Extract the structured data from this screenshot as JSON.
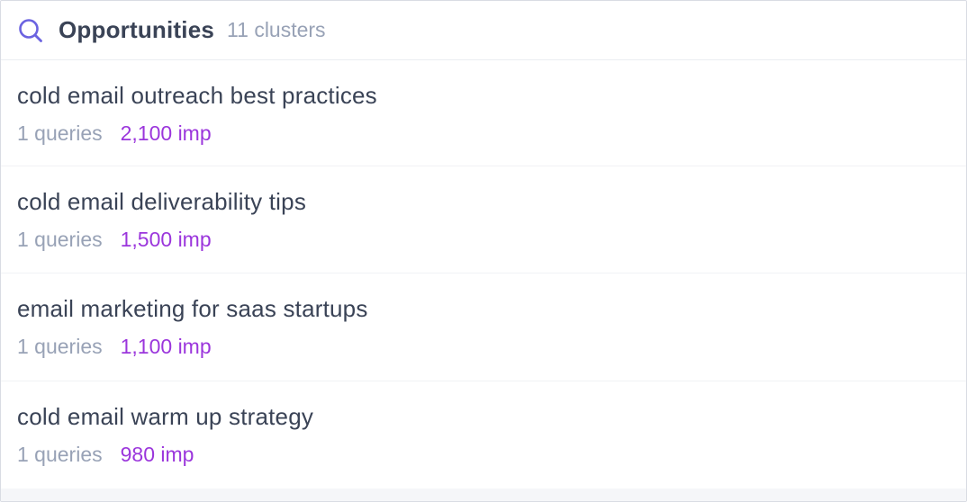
{
  "header": {
    "icon": "search-icon",
    "title": "Opportunities",
    "count": "11 clusters",
    "accent_color": "#6b63e0"
  },
  "clusters": [
    {
      "name": "cold email outreach best practices",
      "queries": "1 queries",
      "impressions": "2,100 imp"
    },
    {
      "name": "cold email deliverability tips",
      "queries": "1 queries",
      "impressions": "1,500 imp"
    },
    {
      "name": "email marketing for saas startups",
      "queries": "1 queries",
      "impressions": "1,100 imp"
    },
    {
      "name": "cold email warm up strategy",
      "queries": "1 queries",
      "impressions": "980 imp"
    }
  ],
  "colors": {
    "text_primary": "#3a4356",
    "text_muted": "#98a2b6",
    "impressions": "#9b36dc"
  }
}
